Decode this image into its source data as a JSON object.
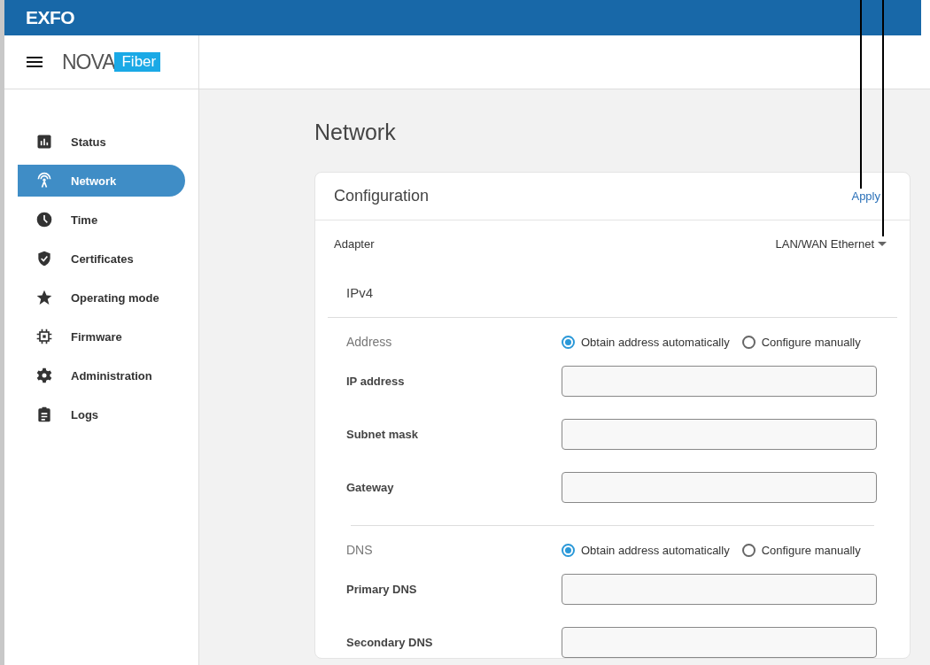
{
  "brand": "EXFO",
  "logo": {
    "name": "NOVA",
    "badge": "Fiber"
  },
  "nav": [
    {
      "label": "Status",
      "kind": "chart",
      "selected": false
    },
    {
      "label": "Network",
      "kind": "antenna",
      "selected": true
    },
    {
      "label": "Time",
      "kind": "clock",
      "selected": false
    },
    {
      "label": "Certificates",
      "kind": "shield",
      "selected": false
    },
    {
      "label": "Operating mode",
      "kind": "star",
      "selected": false
    },
    {
      "label": "Firmware",
      "kind": "chip",
      "selected": false
    },
    {
      "label": "Administration",
      "kind": "gear",
      "selected": false
    },
    {
      "label": "Logs",
      "kind": "clipboard",
      "selected": false
    }
  ],
  "page_title": "Network",
  "card": {
    "title": "Configuration",
    "action": "Apply",
    "adapter_label": "Adapter",
    "adapter_value": "LAN/WAN Ethernet",
    "section": "IPv4",
    "groups": [
      {
        "label": "Address",
        "options": [
          {
            "label": "Obtain address automatically",
            "selected": true
          },
          {
            "label": "Configure manually",
            "selected": false
          }
        ],
        "fields": [
          {
            "label": "IP address"
          },
          {
            "label": "Subnet mask"
          },
          {
            "label": "Gateway"
          }
        ]
      },
      {
        "label": "DNS",
        "options": [
          {
            "label": "Obtain address automatically",
            "selected": true
          },
          {
            "label": "Configure manually",
            "selected": false
          }
        ],
        "fields": [
          {
            "label": "Primary DNS"
          },
          {
            "label": "Secondary DNS"
          }
        ]
      }
    ]
  }
}
